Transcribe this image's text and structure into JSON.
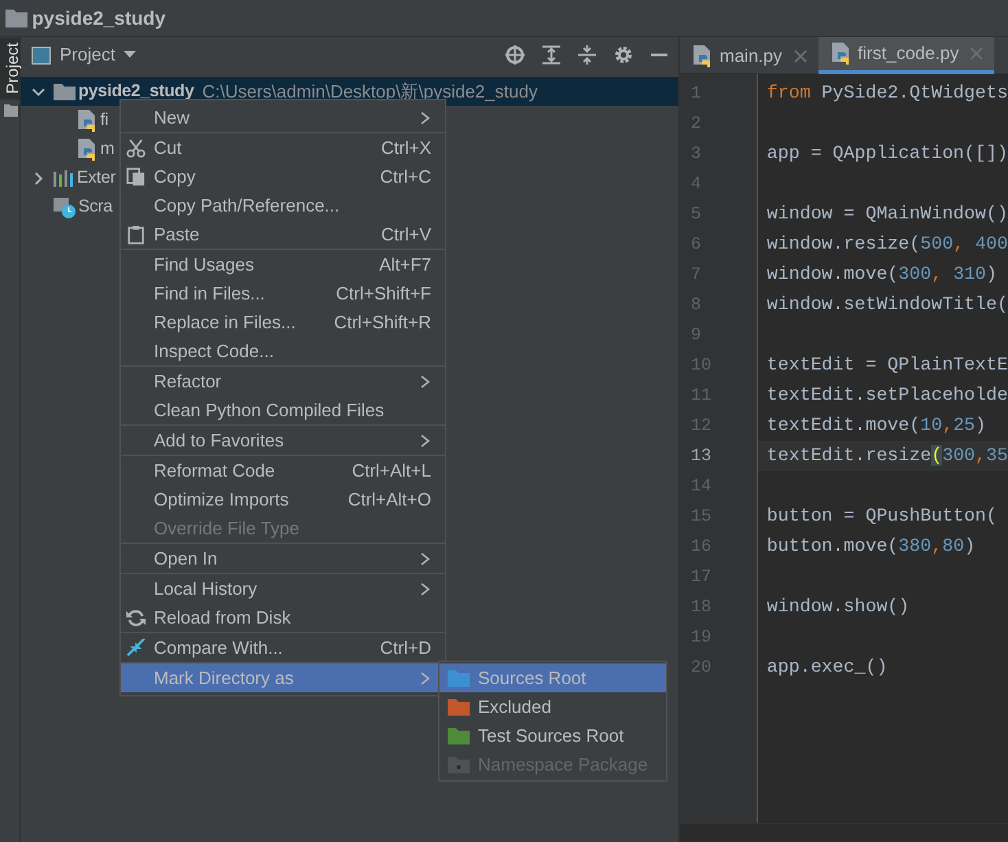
{
  "window": {
    "title": "pyside2_study"
  },
  "side_strip": {
    "label": "Project"
  },
  "project_panel": {
    "title": "Project"
  },
  "tree": [
    {
      "label": "pyside2_study",
      "path": "C:\\Users\\admin\\Desktop\\新\\pyside2_study",
      "kind": "folder",
      "expanded": true,
      "selected": true,
      "children": [
        {
          "label": "fi",
          "kind": "python"
        },
        {
          "label": "m",
          "kind": "python"
        }
      ]
    },
    {
      "label": "Exter",
      "kind": "libraries",
      "expanded": false
    },
    {
      "label": "Scra",
      "kind": "scratches"
    }
  ],
  "context_menu": {
    "groups": [
      [
        {
          "label": "New",
          "submenu": true
        }
      ],
      [
        {
          "label": "Cut",
          "shortcut": "Ctrl+X",
          "kind": "cut"
        },
        {
          "label": "Copy",
          "shortcut": "Ctrl+C",
          "kind": "copy"
        },
        {
          "label": "Copy Path/Reference..."
        },
        {
          "label": "Paste",
          "shortcut": "Ctrl+V",
          "kind": "paste"
        }
      ],
      [
        {
          "label": "Find Usages",
          "shortcut": "Alt+F7"
        },
        {
          "label": "Find in Files...",
          "shortcut": "Ctrl+Shift+F"
        },
        {
          "label": "Replace in Files...",
          "shortcut": "Ctrl+Shift+R"
        },
        {
          "label": "Inspect Code..."
        }
      ],
      [
        {
          "label": "Refactor",
          "submenu": true
        },
        {
          "label": "Clean Python Compiled Files"
        }
      ],
      [
        {
          "label": "Add to Favorites",
          "submenu": true
        }
      ],
      [
        {
          "label": "Reformat Code",
          "shortcut": "Ctrl+Alt+L"
        },
        {
          "label": "Optimize Imports",
          "shortcut": "Ctrl+Alt+O"
        },
        {
          "label": "Override File Type",
          "disabled": true
        }
      ],
      [
        {
          "label": "Open In",
          "submenu": true
        }
      ],
      [
        {
          "label": "Local History",
          "submenu": true
        },
        {
          "label": "Reload from Disk",
          "kind": "reload"
        }
      ],
      [
        {
          "label": "Compare With...",
          "shortcut": "Ctrl+D",
          "kind": "compare"
        }
      ],
      [
        {
          "label": "Mark Directory as",
          "submenu": true,
          "selected": true
        }
      ]
    ]
  },
  "submenu": [
    {
      "label": "Sources Root",
      "color": "#3d8fd1",
      "selected": true,
      "disabled": false
    },
    {
      "label": "Excluded",
      "color": "#c2572b",
      "selected": false,
      "disabled": false
    },
    {
      "label": "Test Sources Root",
      "color": "#4e8a3a",
      "selected": false,
      "disabled": false
    },
    {
      "label": "Namespace Package",
      "color": "#4f5254",
      "selected": false,
      "disabled": true
    }
  ],
  "tabs": [
    {
      "label": "main.py",
      "selected": false
    },
    {
      "label": "first_code.py",
      "selected": true
    }
  ],
  "editor": {
    "lines": [
      {
        "number": "1",
        "tokens": [
          {
            "text": "from",
            "kind": "keyword"
          },
          {
            "text": " PySide2.QtWidgets",
            "kind": "plain"
          }
        ]
      },
      {
        "number": "2"
      },
      {
        "number": "3",
        "tokens": [
          {
            "text": "app = QApplication([])",
            "kind": "plain"
          }
        ]
      },
      {
        "number": "4"
      },
      {
        "number": "5",
        "tokens": [
          {
            "text": "window = QMainWindow()",
            "kind": "plain"
          }
        ]
      },
      {
        "number": "6",
        "tokens": [
          {
            "text": "window.resize(",
            "kind": "plain"
          },
          {
            "text": "500",
            "kind": "number"
          },
          {
            "text": ", ",
            "kind": "keyword"
          },
          {
            "text": "400",
            "kind": "number"
          }
        ]
      },
      {
        "number": "7",
        "tokens": [
          {
            "text": "window.move(",
            "kind": "plain"
          },
          {
            "text": "300",
            "kind": "number"
          },
          {
            "text": ", ",
            "kind": "keyword"
          },
          {
            "text": "310",
            "kind": "number"
          },
          {
            "text": ")",
            "kind": "plain"
          }
        ]
      },
      {
        "number": "8",
        "tokens": [
          {
            "text": "window.setWindowTitle(",
            "kind": "plain"
          }
        ]
      },
      {
        "number": "9"
      },
      {
        "number": "10",
        "tokens": [
          {
            "text": "textEdit = QPlainTextE",
            "kind": "plain"
          }
        ]
      },
      {
        "number": "11",
        "tokens": [
          {
            "text": "textEdit.setPlaceholde",
            "kind": "plain"
          }
        ]
      },
      {
        "number": "12",
        "tokens": [
          {
            "text": "textEdit.move(",
            "kind": "plain"
          },
          {
            "text": "10",
            "kind": "number"
          },
          {
            "text": ",",
            "kind": "keyword"
          },
          {
            "text": "25",
            "kind": "number"
          },
          {
            "text": ")",
            "kind": "plain"
          }
        ]
      },
      {
        "number": "13",
        "current": true,
        "tokens": [
          {
            "text": "textEdit.resize",
            "kind": "plain"
          },
          {
            "text": "(",
            "kind": "match"
          },
          {
            "text": "300",
            "kind": "number"
          },
          {
            "text": ",",
            "kind": "keyword"
          },
          {
            "text": "35",
            "kind": "number"
          }
        ]
      },
      {
        "number": "14"
      },
      {
        "number": "15",
        "tokens": [
          {
            "text": "button = QPushButton(",
            "kind": "plain"
          }
        ]
      },
      {
        "number": "16",
        "tokens": [
          {
            "text": "button.move(",
            "kind": "plain"
          },
          {
            "text": "380",
            "kind": "number"
          },
          {
            "text": ",",
            "kind": "keyword"
          },
          {
            "text": "80",
            "kind": "number"
          },
          {
            "text": ")",
            "kind": "plain"
          }
        ]
      },
      {
        "number": "17"
      },
      {
        "number": "18",
        "tokens": [
          {
            "text": "window.show()",
            "kind": "plain"
          }
        ]
      },
      {
        "number": "19"
      },
      {
        "number": "20",
        "tokens": [
          {
            "text": "app.exec_()",
            "kind": "plain"
          }
        ]
      }
    ]
  }
}
